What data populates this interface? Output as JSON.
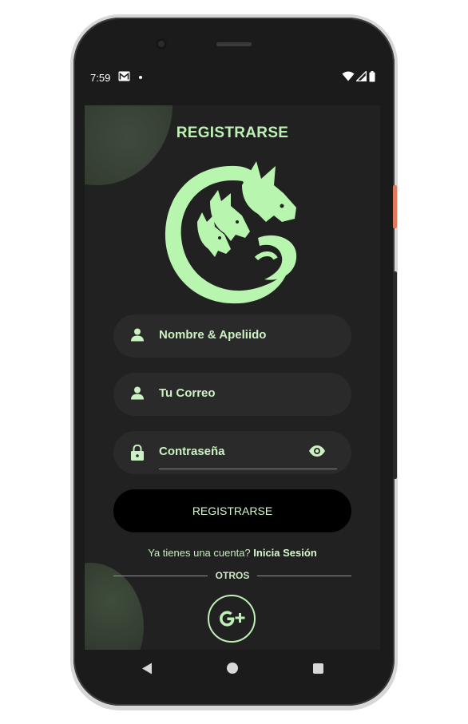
{
  "status_bar": {
    "time": "7:59",
    "icons": [
      "gmail-icon",
      "notification-dot-icon",
      "wifi-icon",
      "signal-icon",
      "battery-icon"
    ]
  },
  "screen": {
    "title": "REGISTRARSE",
    "logo": "hydra-dragon-logo",
    "fields": {
      "name": {
        "label": "Nombre & Apeliido",
        "icon": "person-icon"
      },
      "email": {
        "label": "Tu Correo",
        "icon": "person-icon"
      },
      "password": {
        "label": "Contraseña",
        "icon": "lock-icon",
        "toggle_icon": "eye-icon"
      }
    },
    "register_button": "REGISTRARSE",
    "have_account_text": "Ya tienes una cuenta?",
    "login_link": "Inicia Sesión",
    "divider_label": "OTROS",
    "google_button_icon": "google-plus-icon"
  },
  "navbar": {
    "icons": [
      "back-icon",
      "home-icon",
      "recents-icon"
    ]
  },
  "colors": {
    "accent": "#bdf0b4",
    "background": "#212121",
    "field_background": "#2a2a2a",
    "button_background": "#000000"
  }
}
